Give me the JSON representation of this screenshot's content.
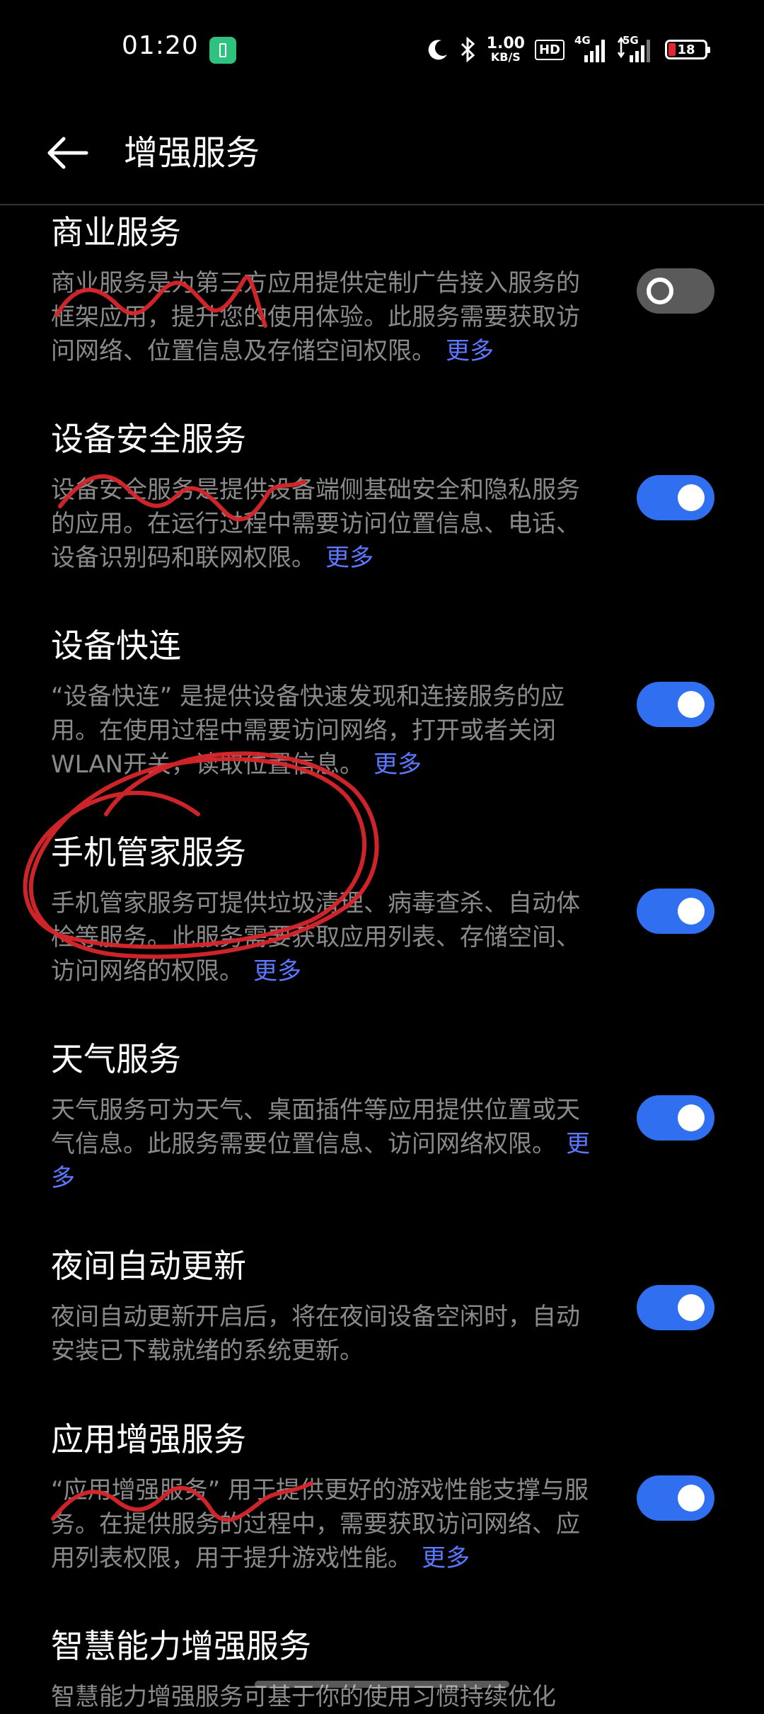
{
  "status_bar": {
    "time": "01:20",
    "net_speed_value": "1.00",
    "net_speed_unit": "KB/S",
    "hd_label": "HD",
    "sim1_label": "4G",
    "sim2_label": "5G",
    "battery_level": "18",
    "icons": [
      "moon-icon",
      "bluetooth-icon",
      "signal-icon",
      "battery-icon"
    ]
  },
  "header": {
    "title": "增强服务",
    "back_icon": "arrow-left-icon"
  },
  "items": [
    {
      "title": "商业服务",
      "description": "商业服务是为第三方应用提供定制广告接入服务的框架应用，提升您的使用体验。此服务需要获取访问网络、位置信息及存储空间权限。",
      "more": "更多",
      "enabled": false
    },
    {
      "title": "设备安全服务",
      "description": "设备安全服务是提供设备端侧基础安全和隐私服务的应用。在运行过程中需要访问位置信息、电话、设备识别码和联网权限。",
      "more": "更多",
      "enabled": true
    },
    {
      "title": "设备快连",
      "description": "“设备快连” 是提供设备快速发现和连接服务的应用。在使用过程中需要访问网络，打开或者关闭WLAN开关，读取位置信息。",
      "more": "更多",
      "enabled": true
    },
    {
      "title": "手机管家服务",
      "description": "手机管家服务可提供垃圾清理、病毒查杀、自动体检等服务。此服务需要获取应用列表、存储空间、访问网络的权限。",
      "more": "更多",
      "enabled": true
    },
    {
      "title": "天气服务",
      "description": "天气服务可为天气、桌面插件等应用提供位置或天气信息。此服务需要位置信息、访问网络权限。",
      "more": "更多",
      "enabled": true
    },
    {
      "title": "夜间自动更新",
      "description": "夜间自动更新开启后，将在夜间设备空闲时，自动安装已下载就绪的系统更新。",
      "more": "",
      "enabled": true
    },
    {
      "title": "应用增强服务",
      "description": "“应用增强服务” 用于提供更好的游戏性能支撑与服务。在提供服务的过程中，需要获取访问网络、应用列表权限，用于提升游戏性能。",
      "more": "更多",
      "enabled": true
    },
    {
      "title": "智慧能力增强服务",
      "description": "智慧能力增强服务可基于你的使用习惯持续优化",
      "more": "",
      "enabled": true
    }
  ],
  "colors": {
    "background": "#000000",
    "toggle_on": "#2f6ff0",
    "toggle_off": "#5a5a5a",
    "link": "#5b78ff",
    "annotation": "#d8262c"
  }
}
